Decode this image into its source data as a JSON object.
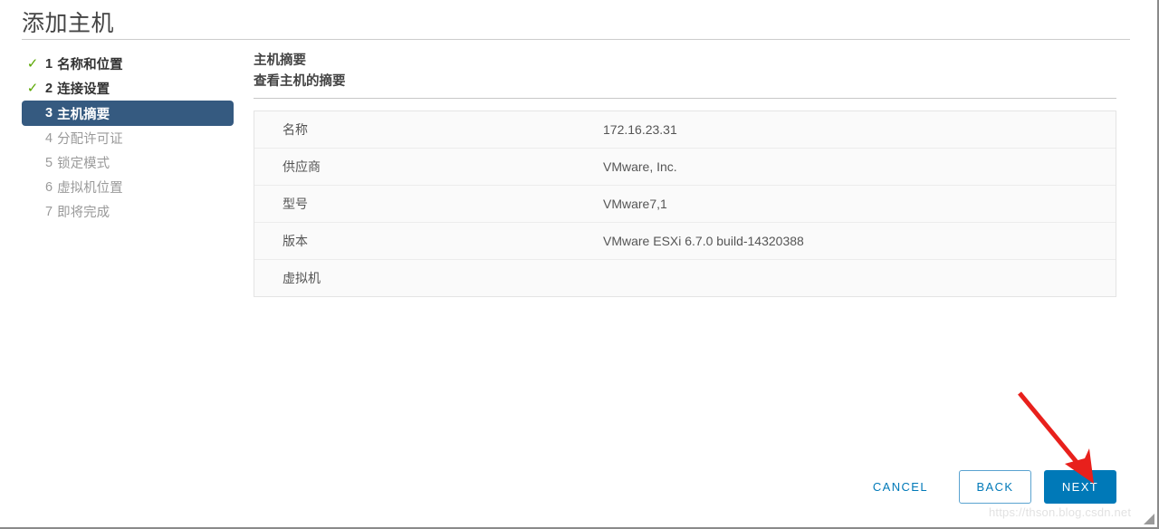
{
  "window": {
    "title": "添加主机"
  },
  "steps": [
    {
      "number": "1",
      "label": "名称和位置",
      "state": "done",
      "icon": "check-icon"
    },
    {
      "number": "2",
      "label": "连接设置",
      "state": "done",
      "icon": "check-icon"
    },
    {
      "number": "3",
      "label": "主机摘要",
      "state": "active",
      "icon": ""
    },
    {
      "number": "4",
      "label": "分配许可证",
      "state": "pending",
      "icon": ""
    },
    {
      "number": "5",
      "label": "锁定模式",
      "state": "pending",
      "icon": ""
    },
    {
      "number": "6",
      "label": "虚拟机位置",
      "state": "pending",
      "icon": ""
    },
    {
      "number": "7",
      "label": "即将完成",
      "state": "pending",
      "icon": ""
    }
  ],
  "main": {
    "heading": "主机摘要",
    "subheading": "查看主机的摘要",
    "rows": [
      {
        "label": "名称",
        "value": "172.16.23.31"
      },
      {
        "label": "供应商",
        "value": "VMware, Inc."
      },
      {
        "label": "型号",
        "value": "VMware7,1"
      },
      {
        "label": "版本",
        "value": "VMware ESXi 6.7.0 build-14320388"
      },
      {
        "label": "虚拟机",
        "value": ""
      }
    ]
  },
  "footer": {
    "cancel_label": "CANCEL",
    "back_label": "BACK",
    "next_label": "NEXT"
  },
  "annotation": {
    "arrow_color": "#e8201c",
    "target": "next-button"
  },
  "watermark": {
    "text": "https://thson.blog.csdn.net"
  },
  "colors": {
    "accent_blue": "#0079b8",
    "active_step_bg": "#355a80",
    "check_green": "#5aa700",
    "text_primary": "#444444",
    "text_muted": "#9a9a9a"
  }
}
